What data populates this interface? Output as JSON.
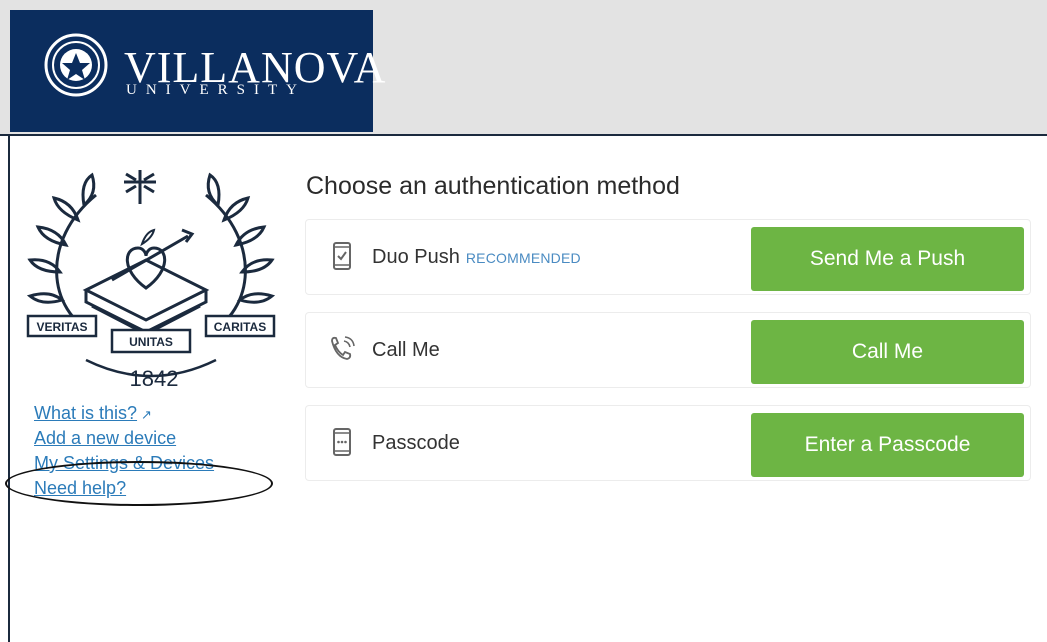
{
  "header": {
    "logo_word": "VILLANOVA",
    "logo_sub": "UNIVERSITY"
  },
  "crest": {
    "year": "1842",
    "banner_left": "VERITAS",
    "banner_center": "UNITAS",
    "banner_right": "CARITAS"
  },
  "links": {
    "what_is_this": "What is this?",
    "add_device": "Add a new device",
    "settings": "My Settings & Devices",
    "help": "Need help?"
  },
  "main": {
    "heading": "Choose an authentication method",
    "methods": [
      {
        "label": "Duo Push",
        "tag": "RECOMMENDED",
        "button": "Send Me a Push",
        "icon": "phone-push-icon"
      },
      {
        "label": "Call Me",
        "tag": "",
        "button": "Call Me",
        "icon": "phone-call-icon"
      },
      {
        "label": "Passcode",
        "tag": "",
        "button": "Enter a Passcode",
        "icon": "passcode-icon"
      }
    ]
  },
  "colors": {
    "brand_navy": "#0b2d5e",
    "button_green": "#6db544",
    "link_blue": "#2b7bb9"
  }
}
